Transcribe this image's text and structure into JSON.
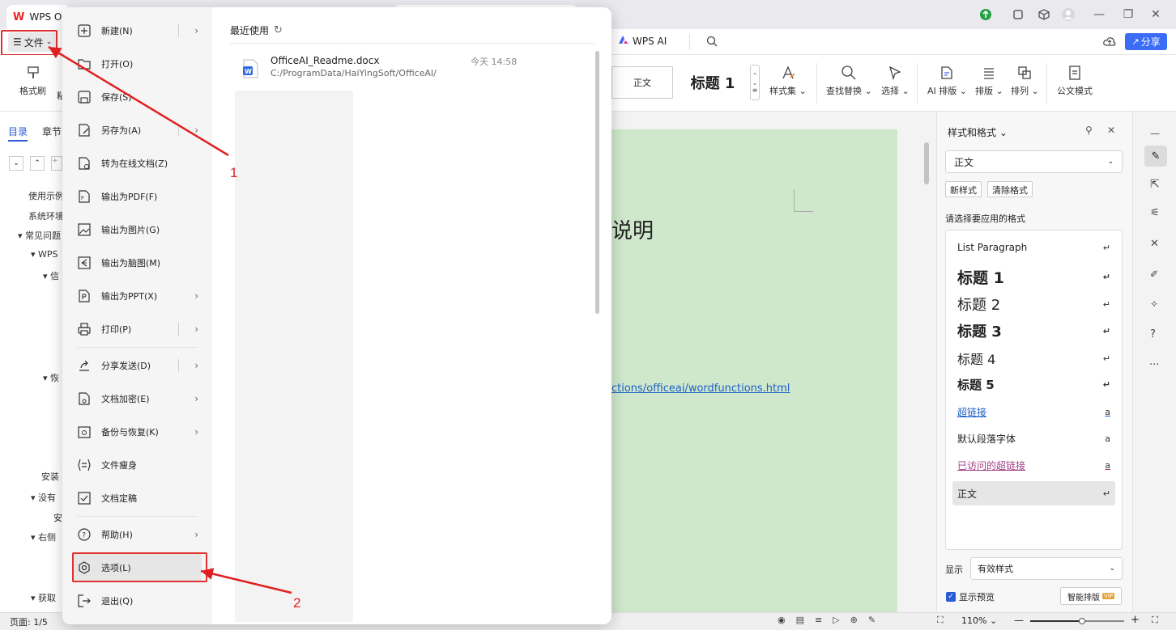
{
  "titlebar": {
    "app_tab": "WPS O",
    "window_controls": [
      "minimize",
      "restore",
      "close"
    ]
  },
  "menubar": {
    "file_label": "文件",
    "wps_ai_label": "WPS AI",
    "share_label": "分享"
  },
  "ribbon": {
    "left_items": [
      {
        "label": "格式刷",
        "icon": "format-painter-icon"
      },
      {
        "label": "粘",
        "icon": "paste-icon"
      }
    ],
    "style_box_zhengwen": "正文",
    "style_box_heading": "标题 1",
    "items": [
      {
        "label": "样式集",
        "icon": "style-set-icon"
      },
      {
        "label": "查找替换",
        "icon": "search-icon"
      },
      {
        "label": "选择",
        "icon": "cursor-icon"
      },
      {
        "label": "AI 排版",
        "icon": "ai-layout-icon"
      },
      {
        "label": "排版",
        "icon": "layout-icon"
      },
      {
        "label": "排列",
        "icon": "arrange-icon"
      },
      {
        "label": "公文模式",
        "icon": "official-doc-icon"
      }
    ]
  },
  "navpane": {
    "tabs": [
      "目录",
      "章节"
    ],
    "items": [
      "使用示例",
      "系统环境",
      "常见问题",
      "WPS",
      "信",
      "恢",
      "安装",
      "没有",
      "安",
      "右侧",
      "获取"
    ]
  },
  "document": {
    "heading_fragment": "说明",
    "link_fragment": "ctions/officeai/wordfunctions.html"
  },
  "filemenu": {
    "items": [
      {
        "label": "新建(N)",
        "icon": "new-doc-icon",
        "submenu": true
      },
      {
        "label": "打开(O)",
        "icon": "open-folder-icon",
        "submenu": false
      },
      {
        "label": "保存(S)",
        "icon": "save-icon",
        "submenu": false
      },
      {
        "label": "另存为(A)",
        "icon": "save-as-icon",
        "submenu": true
      },
      {
        "label": "转为在线文档(Z)",
        "icon": "online-doc-icon",
        "submenu": false
      },
      {
        "label": "输出为PDF(F)",
        "icon": "pdf-icon",
        "submenu": false
      },
      {
        "label": "输出为图片(G)",
        "icon": "image-icon",
        "submenu": false
      },
      {
        "label": "输出为脑图(M)",
        "icon": "mindmap-icon",
        "submenu": false
      },
      {
        "label": "输出为PPT(X)",
        "icon": "ppt-icon",
        "submenu": true
      },
      {
        "label": "打印(P)",
        "icon": "print-icon",
        "submenu": true
      },
      {
        "label": "分享发送(D)",
        "icon": "share-icon",
        "submenu": true
      },
      {
        "label": "文档加密(E)",
        "icon": "encrypt-icon",
        "submenu": true
      },
      {
        "label": "备份与恢复(K)",
        "icon": "backup-icon",
        "submenu": true
      },
      {
        "label": "文件瘦身",
        "icon": "slim-icon",
        "submenu": false
      },
      {
        "label": "文档定稿",
        "icon": "finalize-icon",
        "submenu": false
      },
      {
        "label": "帮助(H)",
        "icon": "help-icon",
        "submenu": true
      },
      {
        "label": "选项(L)",
        "icon": "options-gear-icon",
        "submenu": false
      },
      {
        "label": "退出(Q)",
        "icon": "exit-icon",
        "submenu": false
      }
    ],
    "recent_header": "最近使用",
    "recent_files": [
      {
        "name": "OfficeAI_Readme.docx",
        "path": "C:/ProgramData/HaiYingSoft/OfficeAI/",
        "time": "今天 14:58"
      }
    ]
  },
  "annotations": {
    "label_1": "1",
    "label_2": "2",
    "color": "#e02020"
  },
  "stylepanel": {
    "title": "样式和格式",
    "current_style": "正文",
    "new_style_btn": "新样式",
    "clear_format_btn": "清除格式",
    "prompt": "请选择要应用的格式",
    "styles": [
      {
        "name": "List Paragraph",
        "kind": "normal",
        "mark": "↵"
      },
      {
        "name": "标题 1",
        "kind": "h1",
        "mark": "↵"
      },
      {
        "name": "标题 2",
        "kind": "h2",
        "mark": "↵"
      },
      {
        "name": "标题 3",
        "kind": "h3",
        "mark": "↵"
      },
      {
        "name": "标题 4",
        "kind": "h4",
        "mark": "↵"
      },
      {
        "name": "标题 5",
        "kind": "h5",
        "mark": "↵"
      },
      {
        "name": "超链接",
        "kind": "link",
        "mark": "a"
      },
      {
        "name": "默认段落字体",
        "kind": "normal",
        "mark": "a"
      },
      {
        "name": "已访问的超链接",
        "kind": "visited",
        "mark": "a"
      },
      {
        "name": "正文",
        "kind": "selected",
        "mark": "↵"
      }
    ],
    "show_label": "显示",
    "show_value": "有效样式",
    "preview_label": "显示预览",
    "smart_layout_btn": "智能排版",
    "vip_badge": "VIP"
  },
  "statusbar": {
    "page": "页面: 1/5",
    "zoom": "110%",
    "zoom_level": 0.55
  }
}
